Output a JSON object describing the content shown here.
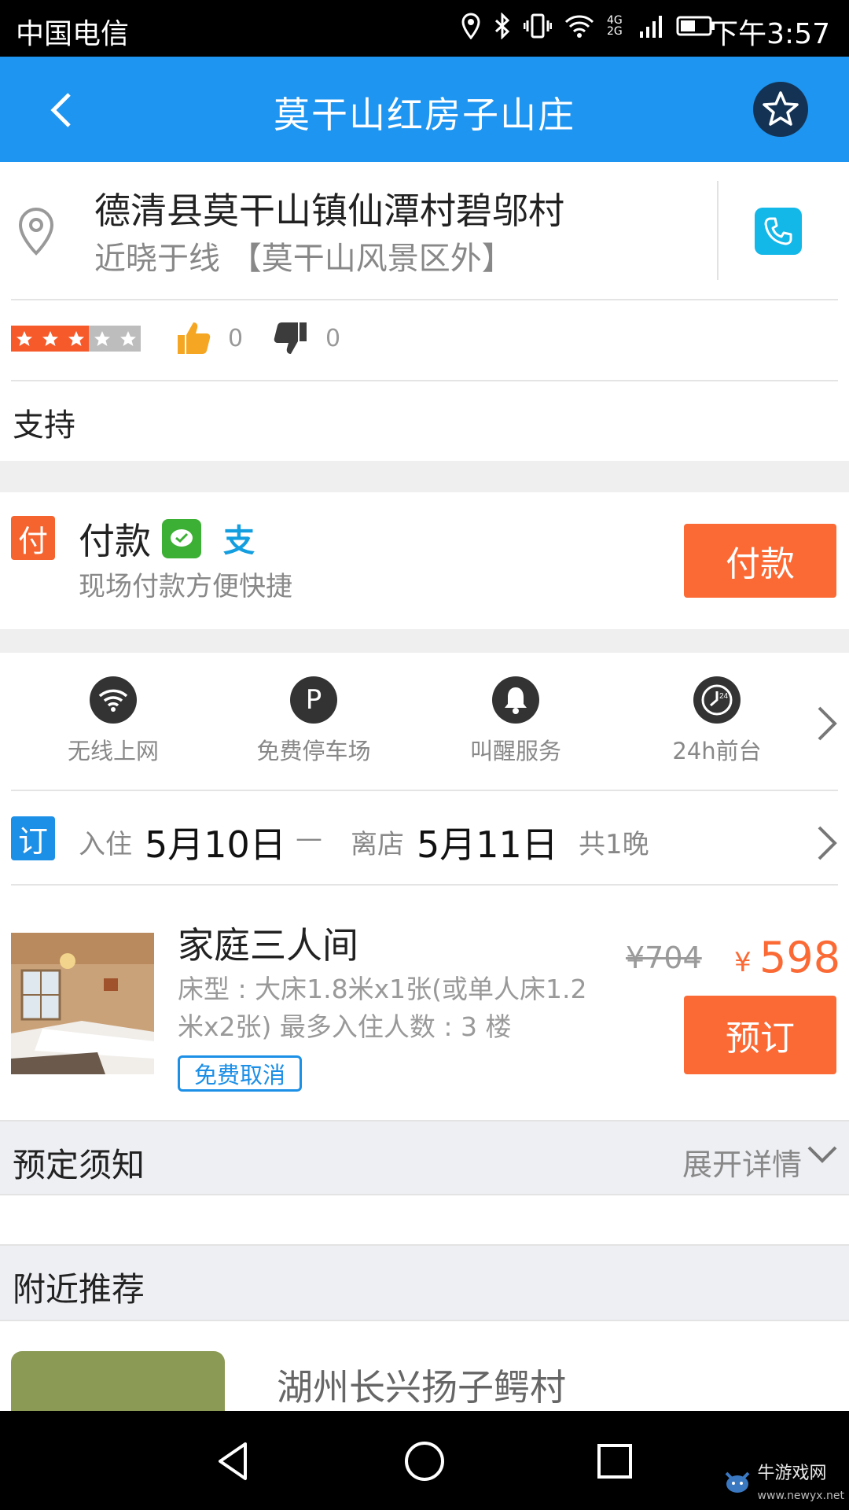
{
  "status_bar": {
    "carrier": "中国电信",
    "network": "4G 2G",
    "time": "下午3:57"
  },
  "header": {
    "title": "莫干山红房子山庄"
  },
  "address": {
    "line1": "德清县莫干山镇仙潭村碧邬村",
    "line2": "近晓于线 【莫干山风景区外】"
  },
  "rating": {
    "stars_filled": 3,
    "stars_total": 5,
    "likes": "0",
    "dislikes": "0"
  },
  "support": {
    "label": "支持"
  },
  "payment": {
    "badge": "付",
    "label": "付款",
    "alipay_glyph": "支",
    "subtitle": "现场付款方便快捷",
    "button": "付款"
  },
  "facilities": [
    {
      "label": "无线上网",
      "icon": "wifi-icon"
    },
    {
      "label": "免费停车场",
      "icon": "parking-icon",
      "glyph": "P"
    },
    {
      "label": "叫醒服务",
      "icon": "bell-icon"
    },
    {
      "label": "24h前台",
      "icon": "clock-24h-icon",
      "glyph": "24"
    }
  ],
  "booking_dates": {
    "badge": "订",
    "checkin_label": "入住",
    "checkin_date": "5月10日",
    "separator": "—",
    "checkout_label": "离店",
    "checkout_date": "5月11日",
    "nights": "共1晚"
  },
  "room": {
    "name": "家庭三人间",
    "desc_line1": "床型 : 大床1.8米x1张(或单人床1.2",
    "desc_line2": "米x2张)  最多入住人数 : 3  楼",
    "tag": "免费取消",
    "original_price": "¥704",
    "currency": "¥",
    "price": "598",
    "book_button": "预订"
  },
  "notice": {
    "title": "预定须知",
    "expand": "展开详情"
  },
  "nearby": {
    "title": "附近推荐",
    "items": [
      {
        "name": "湖州长兴扬子鳄村"
      }
    ]
  },
  "watermark": {
    "name": "牛游戏网",
    "url": "www.newyx.net"
  },
  "colors": {
    "primary": "#1e95f0",
    "accent": "#fb6a35",
    "star_on": "#f75a2a",
    "phone": "#13b7e8"
  }
}
